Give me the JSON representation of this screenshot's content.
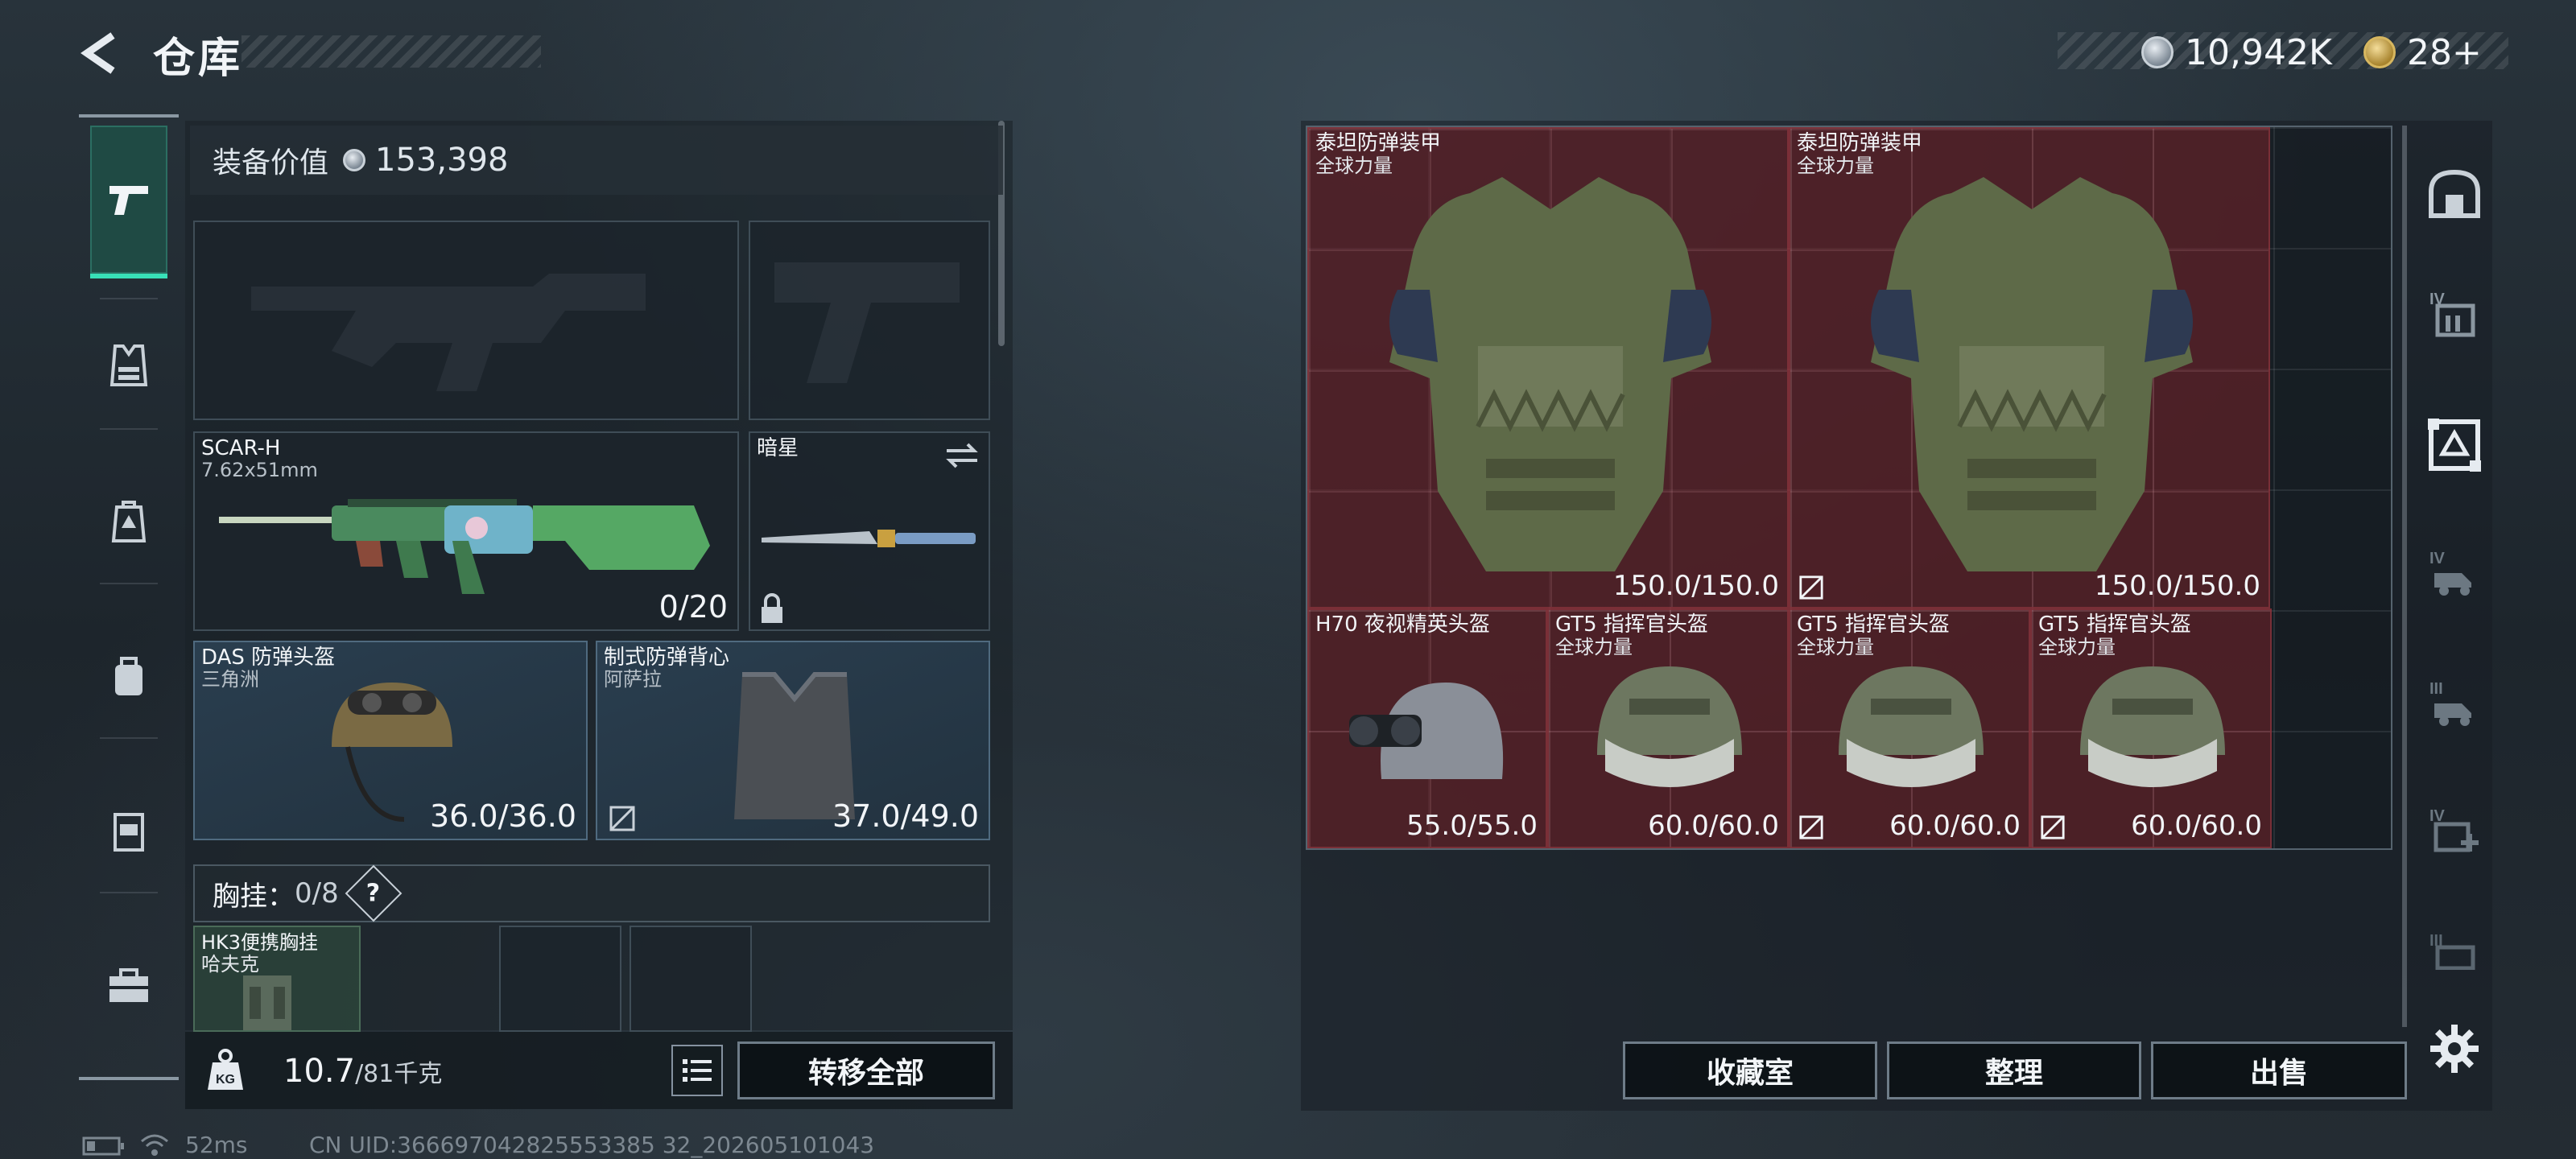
{
  "header": {
    "title": "仓库",
    "silver_amount": "10,942K",
    "gold_amount": "28+"
  },
  "loadout": {
    "equip_value_label": "装备价值",
    "equip_value": "153,398",
    "primary": {
      "name": "SCAR-H",
      "caliber": "7.62x51mm",
      "ammo": "0/20"
    },
    "melee": {
      "name": "暗星"
    },
    "helmet": {
      "name": "DAS 防弹头盔",
      "source": "三角洲",
      "durability": "36.0/36.0"
    },
    "armor": {
      "name": "制式防弹背心",
      "source": "阿萨拉",
      "durability": "37.0/49.0"
    },
    "chest_rig_label": "胸挂：",
    "chest_rig_count": "0/8",
    "chest_rig_help": "?",
    "chest_item": {
      "name": "HK3便携胸挂",
      "source": "哈夫克"
    },
    "weight_current": "10.7",
    "weight_max": "/81千克",
    "transfer_all": "转移全部"
  },
  "inventory": {
    "items": [
      {
        "name": "泰坦防弹装甲",
        "source": "全球力量",
        "durability": "150.0/150.0"
      },
      {
        "name": "泰坦防弹装甲",
        "source": "全球力量",
        "durability": "150.0/150.0"
      },
      {
        "name": "H70 夜视精英头盔",
        "source": "",
        "durability": "55.0/55.0"
      },
      {
        "name": "GT5 指挥官头盔",
        "source": "全球力量",
        "durability": "60.0/60.0"
      },
      {
        "name": "GT5 指挥官头盔",
        "source": "全球力量",
        "durability": "60.0/60.0"
      },
      {
        "name": "GT5 指挥官头盔",
        "source": "全球力量",
        "durability": "60.0/60.0"
      }
    ],
    "buttons": {
      "collection": "收藏室",
      "sort": "整理",
      "sell": "出售"
    }
  },
  "status": {
    "ping": "52ms",
    "uid": "CN UID:366697042825553385 32_202605101043"
  },
  "colors": {
    "accent": "#38e0b7",
    "item_bg": "#78222a",
    "slot_blue": "#2a3e4f"
  },
  "icons": {
    "left_rail": [
      "pistol-icon",
      "vest-icon",
      "backpack-icon",
      "bag-icon",
      "case-icon",
      "toolbox-icon"
    ],
    "right_rail": [
      "garage-icon",
      "storage-iv-icon",
      "storage-active-icon",
      "vehicle-iv-icon",
      "vehicle-iii-icon",
      "medical-iv-icon",
      "storage-iii-icon",
      "settings-icon"
    ]
  }
}
